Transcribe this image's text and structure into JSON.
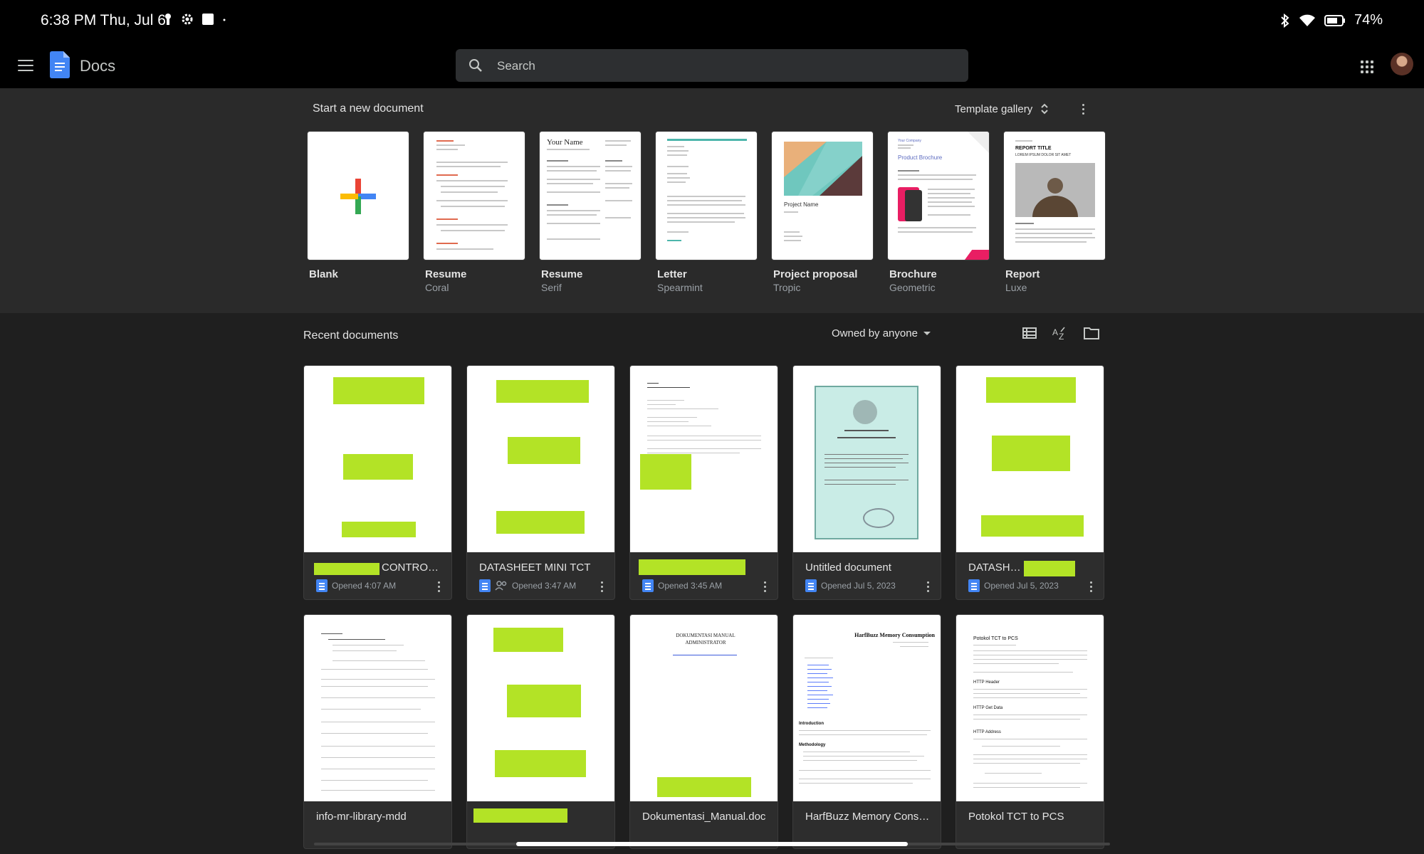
{
  "status_bar": {
    "time": "6:38 PM Thu, Jul 6",
    "battery": "74%"
  },
  "app": {
    "name": "Docs"
  },
  "search": {
    "placeholder": "Search"
  },
  "templates": {
    "title": "Start a new document",
    "gallery_label": "Template gallery",
    "items": [
      {
        "name": "Blank",
        "sub": ""
      },
      {
        "name": "Resume",
        "sub": "Coral"
      },
      {
        "name": "Resume",
        "sub": "Serif"
      },
      {
        "name": "Letter",
        "sub": "Spearmint"
      },
      {
        "name": "Project proposal",
        "sub": "Tropic"
      },
      {
        "name": "Brochure",
        "sub": "Geometric"
      },
      {
        "name": "Report",
        "sub": "Luxe"
      }
    ],
    "thumb_text": {
      "serif_name": "Your Name",
      "project_name": "Project Name",
      "brochure_company": "Your Company",
      "brochure_title": "Product Brochure",
      "report_title": "REPORT TITLE",
      "report_sub": "LOREM IPSUM DOLOR SIT AMET"
    }
  },
  "recent": {
    "title": "Recent documents",
    "owner_filter": "Owned by anyone",
    "docs": [
      {
        "title": "CONTROLL...",
        "opened": "Opened 4:07 AM"
      },
      {
        "title": "DATASHEET MINI TCT",
        "opened": "Opened 3:47 AM"
      },
      {
        "title": "",
        "opened": "Opened 3:45 AM"
      },
      {
        "title": "Untitled document",
        "opened": "Opened Jul 5, 2023"
      },
      {
        "title": "DATASHEET",
        "opened": "Opened Jul 5, 2023"
      },
      {
        "title": "info-mr-library-mdd",
        "opened": ""
      },
      {
        "title": "",
        "opened": ""
      },
      {
        "title": "Dokumentasi_Manual.doc",
        "opened": ""
      },
      {
        "title": "HarfBuzz Memory Consu...",
        "opened": ""
      },
      {
        "title": "Potokol TCT to PCS",
        "opened": ""
      }
    ],
    "thumb_text": {
      "harfbuzz_heading": "HarfBuzz Memory Consumption",
      "harfbuzz_intro": "Introduction",
      "harfbuzz_method": "Methodology",
      "potokol_heading": "Potokol TCT to PCS",
      "potokol_h1": "HTTP Header",
      "potokol_h2": "HTTP Get Data",
      "potokol_h3": "HTTP Address",
      "dokumentasi_head": "DOKUMENTASI MANUAL ADMINISTRATOR"
    }
  },
  "colors": {
    "background": "#1f1f1f",
    "accent": "#4285f4",
    "redaction": "#b3e326"
  }
}
